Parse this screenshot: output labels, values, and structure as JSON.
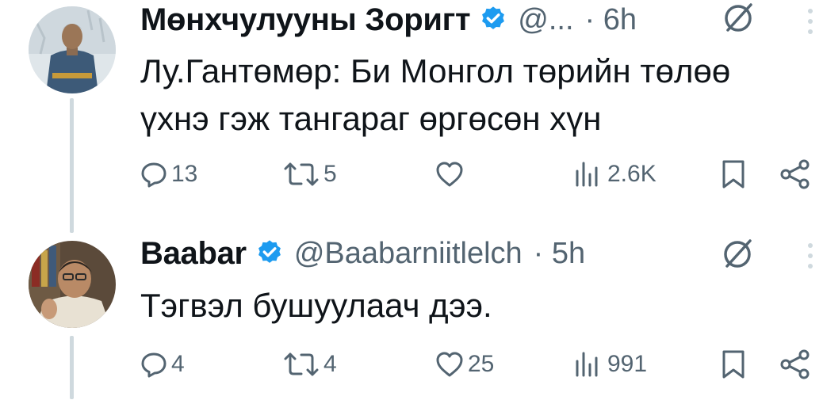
{
  "tweets": [
    {
      "display_name": "Мөнхчулууны Зоригт",
      "handle": "@...",
      "time": "· 6h",
      "text_lines": [
        "Лу.Гантөмөр: Би Монгол төрийн төлөө",
        "үхнэ гэж тангараг өргөсөн хүн"
      ],
      "stats": {
        "replies": "13",
        "reposts": "5",
        "likes": "",
        "views": "2.6K"
      }
    },
    {
      "display_name": "Baabar",
      "handle": "@Baabarniitlelch",
      "time": "· 5h",
      "text_lines": [
        "Тэгвэл бушуулаач дээ."
      ],
      "stats": {
        "replies": "4",
        "reposts": "4",
        "likes": "25",
        "views": "991"
      }
    }
  ],
  "colors": {
    "text_primary": "#0f1419",
    "text_secondary": "#536471",
    "verified_blue": "#1d9bf0",
    "thread_line": "#cfd9de"
  },
  "icons": {
    "verified": "verified-badge-icon",
    "grok": "grok-icon",
    "more": "more-vertical-icon",
    "reply": "reply-icon",
    "repost": "repost-icon",
    "like": "like-icon",
    "views": "views-icon",
    "bookmark": "bookmark-icon",
    "share": "share-icon"
  }
}
